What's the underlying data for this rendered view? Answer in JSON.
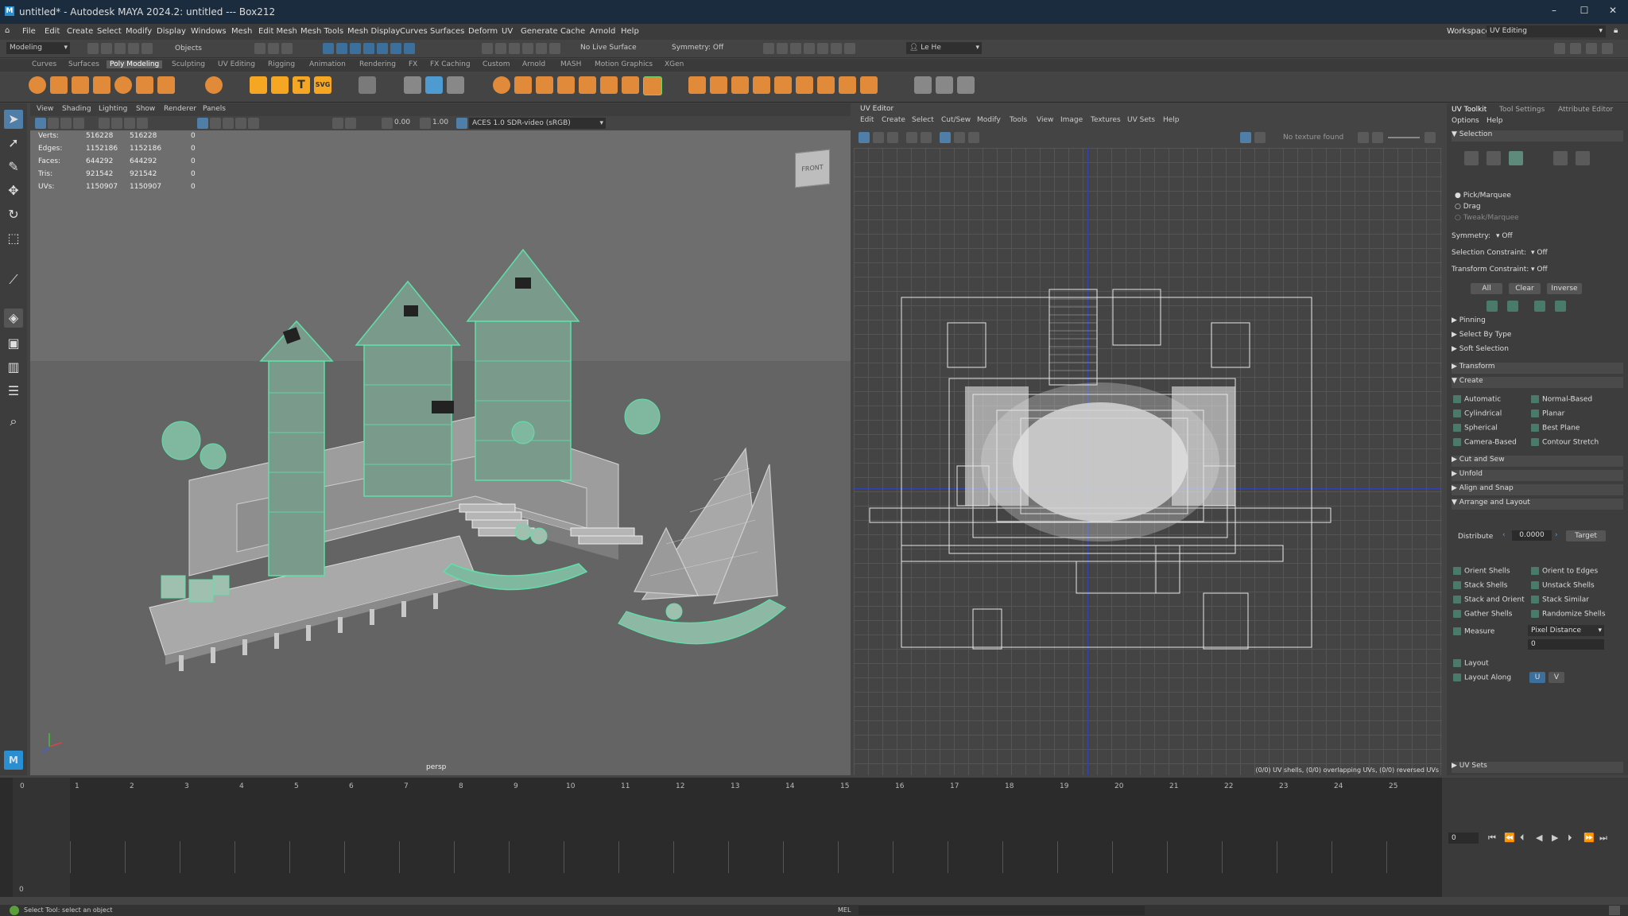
{
  "window": {
    "title": "untitled* - Autodesk MAYA 2024.2: untitled  ---  Box212"
  },
  "menus": [
    "File",
    "Edit",
    "Create",
    "Select",
    "Modify",
    "Display",
    "Windows",
    "Mesh",
    "Edit Mesh",
    "Mesh Tools",
    "Mesh Display",
    "Curves",
    "Surfaces",
    "Deform",
    "UV",
    "Generate",
    "Cache",
    "Arnold",
    "Help"
  ],
  "workspace": {
    "label": "Workspace:",
    "value": "UV Editing"
  },
  "statusline": {
    "mode": "Modeling",
    "objects": "Objects",
    "live_surface": "No Live Surface",
    "symmetry": "Symmetry: Off",
    "user": "Le He"
  },
  "shelf_tabs": [
    "Curves",
    "Surfaces",
    "Poly Modeling",
    "Sculpting",
    "UV Editing",
    "Rigging",
    "Animation",
    "Rendering",
    "FX",
    "FX Caching",
    "Custom",
    "Arnold",
    "MASH",
    "Motion Graphics",
    "XGen"
  ],
  "shelf_active": "Poly Modeling",
  "viewport": {
    "menu": [
      "View",
      "Shading",
      "Lighting",
      "Show",
      "Renderer",
      "Panels"
    ],
    "exposure": "0.00",
    "gamma": "1.00",
    "colorspace": "ACES 1.0 SDR-video (sRGB)",
    "camera": "persp",
    "cube_label": "FRONT",
    "hud": [
      {
        "label": "Verts:",
        "a": "516228",
        "b": "516228",
        "c": "0"
      },
      {
        "label": "Edges:",
        "a": "1152186",
        "b": "1152186",
        "c": "0"
      },
      {
        "label": "Faces:",
        "a": "644292",
        "b": "644292",
        "c": "0"
      },
      {
        "label": "Tris:",
        "a": "921542",
        "b": "921542",
        "c": "0"
      },
      {
        "label": "UVs:",
        "a": "1150907",
        "b": "1150907",
        "c": "0"
      }
    ]
  },
  "uv_editor": {
    "title": "UV Editor",
    "menu": [
      "Edit",
      "Create",
      "Select",
      "Cut/Sew",
      "Modify",
      "Tools",
      "View",
      "Image",
      "Textures",
      "UV Sets",
      "Help"
    ],
    "no_texture": "No texture found",
    "status": "(0/0) UV shells, (0/0) overlapping UVs, (0/0) reversed UVs"
  },
  "uv_toolkit": {
    "tabs": [
      "UV Toolkit",
      "Tool Settings",
      "Attribute Editor"
    ],
    "submenu": [
      "Options",
      "Help"
    ],
    "selection_header": "Selection",
    "pick_options": [
      "Pick/Marquee",
      "Drag",
      "Tweak/Marquee"
    ],
    "symmetry": {
      "label": "Symmetry:",
      "value": "Off"
    },
    "sel_constraint": {
      "label": "Selection Constraint:",
      "value": "Off"
    },
    "xform_constraint": {
      "label": "Transform Constraint:",
      "value": "Off"
    },
    "sel_buttons": [
      "All",
      "Clear",
      "Inverse"
    ],
    "sections_top": [
      "Pinning",
      "Select By Type",
      "Soft Selection",
      "Transform"
    ],
    "create_header": "Create",
    "create_buttons": [
      "Automatic",
      "Normal-Based",
      "Cylindrical",
      "Planar",
      "Spherical",
      "Best Plane",
      "Camera-Based",
      "Contour Stretch"
    ],
    "sections_mid": [
      "Cut and Sew",
      "Unfold",
      "Align and Snap"
    ],
    "arrange_header": "Arrange and Layout",
    "distribute": {
      "label": "Distribute",
      "value": "0.0000",
      "target": "Target"
    },
    "arrange_buttons": [
      "Orient Shells",
      "Orient to Edges",
      "Stack Shells",
      "Unstack Shells",
      "Stack and Orient",
      "Stack Similar",
      "Gather Shells",
      "Randomize Shells"
    ],
    "measure": {
      "label": "Measure",
      "value": "Pixel Distance",
      "result": "0"
    },
    "layout": "Layout",
    "layout_along": {
      "label": "Layout Along",
      "u": "U",
      "v": "V"
    },
    "uv_sets": "UV Sets"
  },
  "timeline": {
    "frames": [
      "0",
      "1",
      "2",
      "3",
      "4",
      "5",
      "6",
      "7",
      "8",
      "9",
      "10",
      "11",
      "12",
      "13",
      "14",
      "15",
      "16",
      "17",
      "18",
      "19",
      "20",
      "21",
      "22",
      "23",
      "24",
      "25"
    ],
    "current": "0",
    "start": "0"
  },
  "helpline": {
    "text": "Select Tool: select an object",
    "mel": "MEL"
  },
  "colors": {
    "accent": "#4fa3d9",
    "wire": "#5fe0a8",
    "titlebar": "#1a2c3d"
  }
}
